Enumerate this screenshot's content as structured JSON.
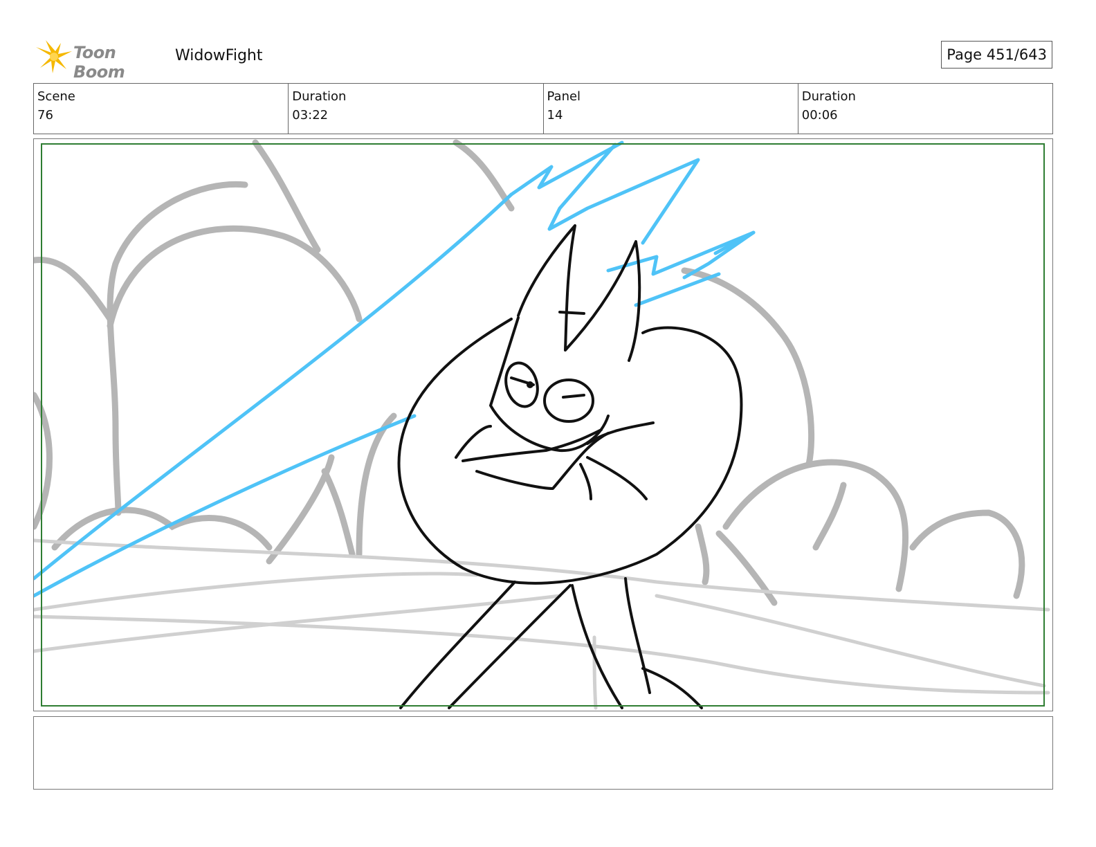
{
  "header": {
    "logo_text": "Toon Boom",
    "project_title": "WidowFight",
    "page_label": "Page 451/643"
  },
  "info": {
    "scene_label": "Scene",
    "scene_value": "76",
    "scene_duration_label": "Duration",
    "scene_duration_value": "03:22",
    "panel_label": "Panel",
    "panel_value": "14",
    "panel_duration_label": "Duration",
    "panel_duration_value": "00:06"
  },
  "notes": {
    "text": ""
  },
  "colors": {
    "safe_frame": "#2e7d32",
    "effect_lines": "#4fc3f7",
    "background_sketch": "#b0b0b0",
    "character_lines": "#111111"
  }
}
